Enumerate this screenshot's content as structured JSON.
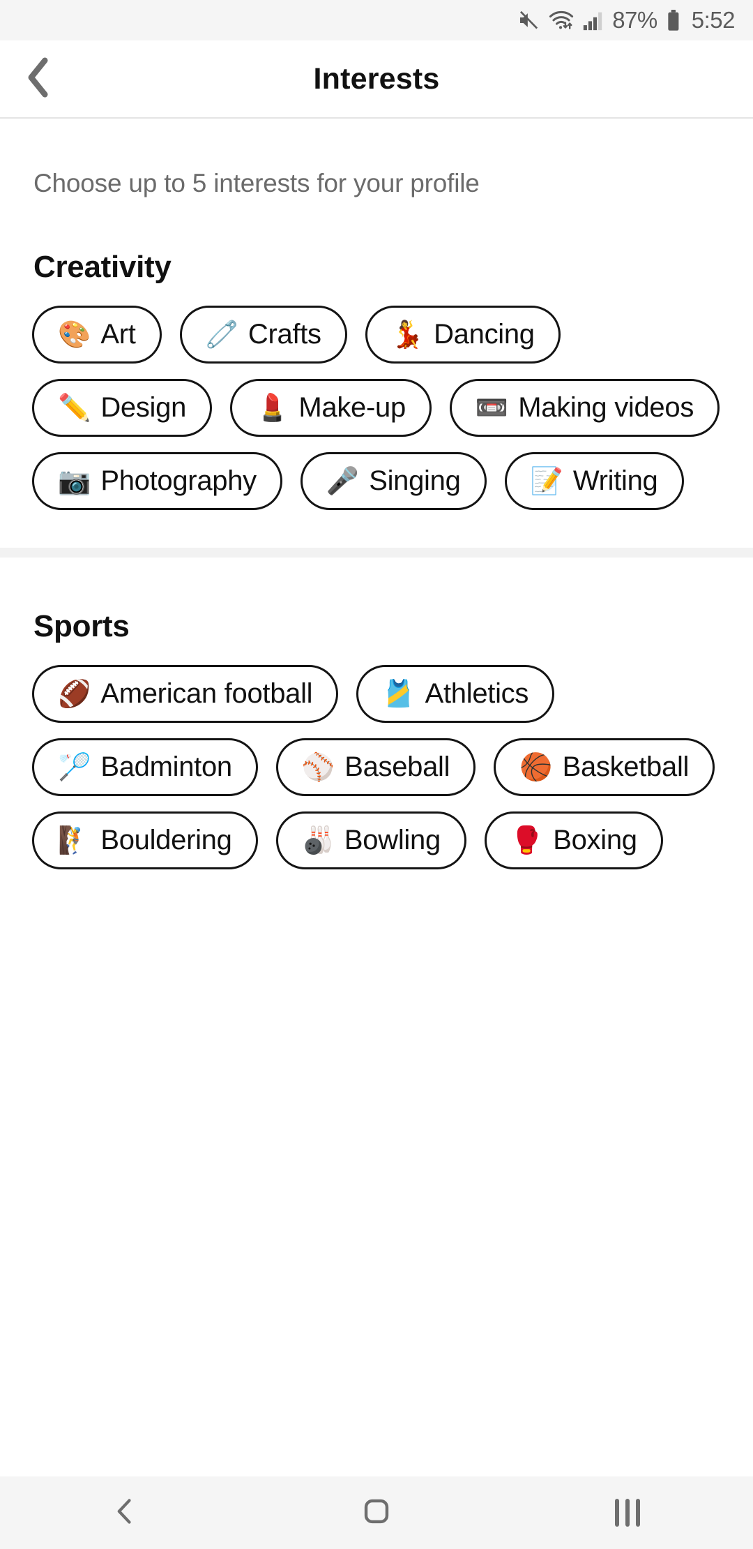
{
  "status_bar": {
    "mute_icon": "mute-icon",
    "wifi_icon": "wifi-icon",
    "signal_icon": "cellular-signal-icon",
    "battery_percent": "87%",
    "battery_icon": "battery-icon",
    "time": "5:52"
  },
  "header": {
    "back_icon": "back-chevron-icon",
    "title": "Interests"
  },
  "content": {
    "subtitle": "Choose up to 5 interests for your profile"
  },
  "sections": [
    {
      "title": "Creativity",
      "chips": [
        {
          "emoji": "🎨",
          "icon_name": "palette-icon",
          "label": "Art"
        },
        {
          "emoji": "🧷",
          "icon_name": "safety-pin-icon",
          "label": "Crafts"
        },
        {
          "emoji": "💃",
          "icon_name": "dancer-icon",
          "label": "Dancing"
        },
        {
          "emoji": "✏️",
          "icon_name": "pencil-icon",
          "label": "Design"
        },
        {
          "emoji": "💄",
          "icon_name": "lipstick-icon",
          "label": "Make-up"
        },
        {
          "emoji": "📼",
          "icon_name": "videocassette-icon",
          "label": "Making videos"
        },
        {
          "emoji": "📷",
          "icon_name": "camera-icon",
          "label": "Photography"
        },
        {
          "emoji": "🎤",
          "icon_name": "microphone-icon",
          "label": "Singing"
        },
        {
          "emoji": "📝",
          "icon_name": "memo-icon",
          "label": "Writing"
        }
      ]
    },
    {
      "title": "Sports",
      "chips": [
        {
          "emoji": "🏈",
          "icon_name": "american-football-icon",
          "label": "American football"
        },
        {
          "emoji": "🎽",
          "icon_name": "running-shirt-icon",
          "label": "Athletics"
        },
        {
          "emoji": "🏸",
          "icon_name": "badminton-icon",
          "label": "Badminton"
        },
        {
          "emoji": "⚾",
          "icon_name": "baseball-icon",
          "label": "Baseball"
        },
        {
          "emoji": "🏀",
          "icon_name": "basketball-icon",
          "label": "Basketball"
        },
        {
          "emoji": "🧗",
          "icon_name": "climber-icon",
          "label": "Bouldering"
        },
        {
          "emoji": "🎳",
          "icon_name": "bowling-icon",
          "label": "Bowling"
        },
        {
          "emoji": "🥊",
          "icon_name": "boxing-glove-icon",
          "label": "Boxing"
        }
      ]
    }
  ],
  "nav_bar": {
    "back_icon": "nav-back-icon",
    "home_icon": "nav-home-icon",
    "recents_icon": "nav-recents-icon"
  },
  "colors": {
    "chip_border": "#141414",
    "status_bg": "#f5f5f5",
    "subtitle": "#6b6b6b"
  }
}
